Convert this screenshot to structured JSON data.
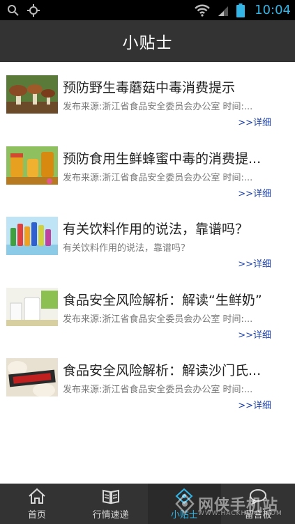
{
  "status_bar": {
    "time": "10:04"
  },
  "header": {
    "title": "小贴士"
  },
  "articles": [
    {
      "title": "预防野生毒蘑菇中毒消费提示",
      "desc": "发布来源:浙江省食品安全委员会办公室 时间:...",
      "more": ">>详细",
      "thumb_icon": "mushroom-thumbnail"
    },
    {
      "title": "预防食用生鲜蜂蜜中毒的消费提...",
      "desc": "发布来源:浙江省食品安全委员会办公室 时间:...",
      "more": ">>详细",
      "thumb_icon": "honey-thumbnail"
    },
    {
      "title": "有关饮料作用的说法，靠谱吗？",
      "desc": "有关饮料作用的说法，靠谱吗？",
      "more": ">>详细",
      "thumb_icon": "drinks-thumbnail"
    },
    {
      "title": "食品安全风险解析：解读“生鲜奶”",
      "desc": "发布来源:浙江省食品安全委员会办公室 时间:...",
      "more": ">>详细",
      "thumb_icon": "milk-thumbnail"
    },
    {
      "title": "食品安全风险解析：解读沙门氏...",
      "desc": "发布来源:浙江省食品安全委员会办公室 时间:...",
      "more": ">>详细",
      "thumb_icon": "salmonella-thumbnail"
    }
  ],
  "tabs": [
    {
      "label": "首页",
      "icon": "home-icon",
      "active": false
    },
    {
      "label": "行情速递",
      "icon": "book-icon",
      "active": false
    },
    {
      "label": "小贴士",
      "icon": "tips-icon",
      "active": true
    },
    {
      "label": "留言板",
      "icon": "message-icon",
      "active": false
    }
  ],
  "watermark": {
    "main": "网侠手机站",
    "sub": "WWW.HACKHOME.COM"
  },
  "colors": {
    "title_bar": "#333333",
    "accent": "#33b5e5",
    "link": "#1a3fa8"
  }
}
